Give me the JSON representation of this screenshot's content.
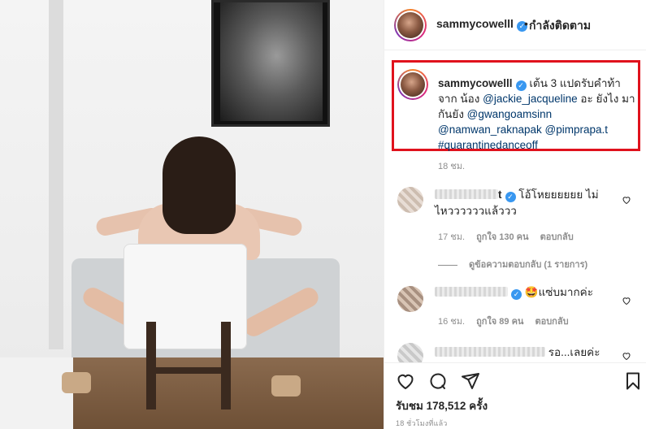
{
  "post": {
    "username": "sammycowelll",
    "dot": "•",
    "following_label": "กำลังติดตาม",
    "caption": {
      "username": "sammycowelll",
      "text_1": "เต้น 3 แปดรับคำท้า จาก น้อง",
      "mention_1": "@jackie_jacqueline",
      "text_2": "อะ ยังไง มากันยัง",
      "mention_2": "@gwangoamsinn",
      "mention_3": "@namwan_raknapak",
      "mention_4": "@pimprapa.t",
      "hashtag": "#quarantinedanceoff",
      "time": "18 ชม."
    },
    "views_label": "รับชม 178,512 ครั้ง",
    "post_time": "18 ชั่วโมงที่แล้ว"
  },
  "comments": [
    {
      "name_visible": "t",
      "verified": true,
      "text": "โอ้โหยยยยยย ไม่ไหววววววแล้ววว",
      "time": "17 ชม.",
      "likes": "ถูกใจ 130 คน",
      "reply": "ตอบกลับ",
      "replies_toggle": "ดูข้อความตอบกลับ (1 รายการ)"
    },
    {
      "name_visible": "",
      "verified": true,
      "emoji": "🤩",
      "text": "แซ่บมากค่ะ",
      "time": "16 ชม.",
      "likes": "ถูกใจ 89 คน",
      "reply": "ตอบกลับ"
    },
    {
      "name_visible": "",
      "verified": false,
      "text": "รอ...เลยค่ะ"
    }
  ],
  "icons": {
    "verified": "verified-badge-icon",
    "like": "heart-icon",
    "comment": "comment-icon",
    "share": "share-icon",
    "save": "bookmark-icon"
  },
  "colors": {
    "accent": "#3897f0",
    "highlight_border": "#e0121d",
    "mention": "#00376b",
    "muted": "#8e8e8e"
  }
}
